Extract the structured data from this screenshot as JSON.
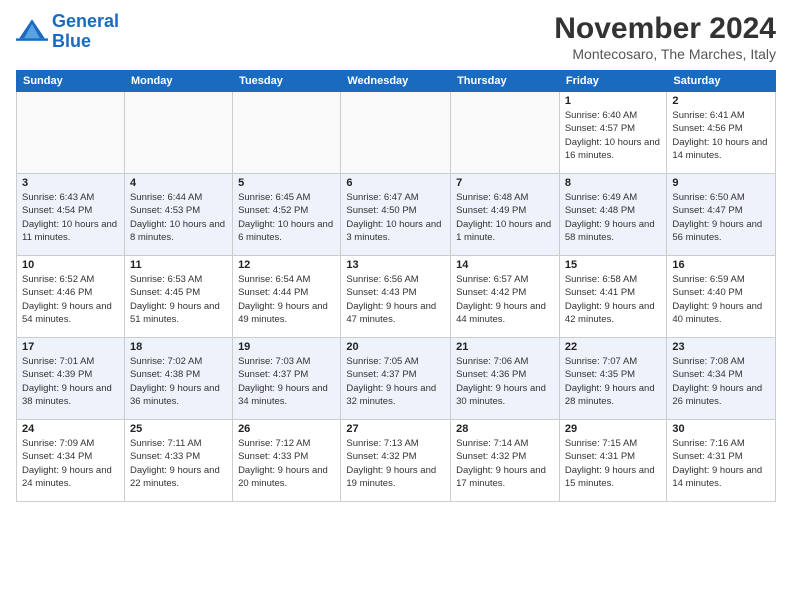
{
  "header": {
    "logo_line1": "General",
    "logo_line2": "Blue",
    "month": "November 2024",
    "location": "Montecosaro, The Marches, Italy"
  },
  "weekdays": [
    "Sunday",
    "Monday",
    "Tuesday",
    "Wednesday",
    "Thursday",
    "Friday",
    "Saturday"
  ],
  "weeks": [
    [
      {
        "day": "",
        "info": ""
      },
      {
        "day": "",
        "info": ""
      },
      {
        "day": "",
        "info": ""
      },
      {
        "day": "",
        "info": ""
      },
      {
        "day": "",
        "info": ""
      },
      {
        "day": "1",
        "info": "Sunrise: 6:40 AM\nSunset: 4:57 PM\nDaylight: 10 hours and 16 minutes."
      },
      {
        "day": "2",
        "info": "Sunrise: 6:41 AM\nSunset: 4:56 PM\nDaylight: 10 hours and 14 minutes."
      }
    ],
    [
      {
        "day": "3",
        "info": "Sunrise: 6:43 AM\nSunset: 4:54 PM\nDaylight: 10 hours and 11 minutes."
      },
      {
        "day": "4",
        "info": "Sunrise: 6:44 AM\nSunset: 4:53 PM\nDaylight: 10 hours and 8 minutes."
      },
      {
        "day": "5",
        "info": "Sunrise: 6:45 AM\nSunset: 4:52 PM\nDaylight: 10 hours and 6 minutes."
      },
      {
        "day": "6",
        "info": "Sunrise: 6:47 AM\nSunset: 4:50 PM\nDaylight: 10 hours and 3 minutes."
      },
      {
        "day": "7",
        "info": "Sunrise: 6:48 AM\nSunset: 4:49 PM\nDaylight: 10 hours and 1 minute."
      },
      {
        "day": "8",
        "info": "Sunrise: 6:49 AM\nSunset: 4:48 PM\nDaylight: 9 hours and 58 minutes."
      },
      {
        "day": "9",
        "info": "Sunrise: 6:50 AM\nSunset: 4:47 PM\nDaylight: 9 hours and 56 minutes."
      }
    ],
    [
      {
        "day": "10",
        "info": "Sunrise: 6:52 AM\nSunset: 4:46 PM\nDaylight: 9 hours and 54 minutes."
      },
      {
        "day": "11",
        "info": "Sunrise: 6:53 AM\nSunset: 4:45 PM\nDaylight: 9 hours and 51 minutes."
      },
      {
        "day": "12",
        "info": "Sunrise: 6:54 AM\nSunset: 4:44 PM\nDaylight: 9 hours and 49 minutes."
      },
      {
        "day": "13",
        "info": "Sunrise: 6:56 AM\nSunset: 4:43 PM\nDaylight: 9 hours and 47 minutes."
      },
      {
        "day": "14",
        "info": "Sunrise: 6:57 AM\nSunset: 4:42 PM\nDaylight: 9 hours and 44 minutes."
      },
      {
        "day": "15",
        "info": "Sunrise: 6:58 AM\nSunset: 4:41 PM\nDaylight: 9 hours and 42 minutes."
      },
      {
        "day": "16",
        "info": "Sunrise: 6:59 AM\nSunset: 4:40 PM\nDaylight: 9 hours and 40 minutes."
      }
    ],
    [
      {
        "day": "17",
        "info": "Sunrise: 7:01 AM\nSunset: 4:39 PM\nDaylight: 9 hours and 38 minutes."
      },
      {
        "day": "18",
        "info": "Sunrise: 7:02 AM\nSunset: 4:38 PM\nDaylight: 9 hours and 36 minutes."
      },
      {
        "day": "19",
        "info": "Sunrise: 7:03 AM\nSunset: 4:37 PM\nDaylight: 9 hours and 34 minutes."
      },
      {
        "day": "20",
        "info": "Sunrise: 7:05 AM\nSunset: 4:37 PM\nDaylight: 9 hours and 32 minutes."
      },
      {
        "day": "21",
        "info": "Sunrise: 7:06 AM\nSunset: 4:36 PM\nDaylight: 9 hours and 30 minutes."
      },
      {
        "day": "22",
        "info": "Sunrise: 7:07 AM\nSunset: 4:35 PM\nDaylight: 9 hours and 28 minutes."
      },
      {
        "day": "23",
        "info": "Sunrise: 7:08 AM\nSunset: 4:34 PM\nDaylight: 9 hours and 26 minutes."
      }
    ],
    [
      {
        "day": "24",
        "info": "Sunrise: 7:09 AM\nSunset: 4:34 PM\nDaylight: 9 hours and 24 minutes."
      },
      {
        "day": "25",
        "info": "Sunrise: 7:11 AM\nSunset: 4:33 PM\nDaylight: 9 hours and 22 minutes."
      },
      {
        "day": "26",
        "info": "Sunrise: 7:12 AM\nSunset: 4:33 PM\nDaylight: 9 hours and 20 minutes."
      },
      {
        "day": "27",
        "info": "Sunrise: 7:13 AM\nSunset: 4:32 PM\nDaylight: 9 hours and 19 minutes."
      },
      {
        "day": "28",
        "info": "Sunrise: 7:14 AM\nSunset: 4:32 PM\nDaylight: 9 hours and 17 minutes."
      },
      {
        "day": "29",
        "info": "Sunrise: 7:15 AM\nSunset: 4:31 PM\nDaylight: 9 hours and 15 minutes."
      },
      {
        "day": "30",
        "info": "Sunrise: 7:16 AM\nSunset: 4:31 PM\nDaylight: 9 hours and 14 minutes."
      }
    ]
  ]
}
